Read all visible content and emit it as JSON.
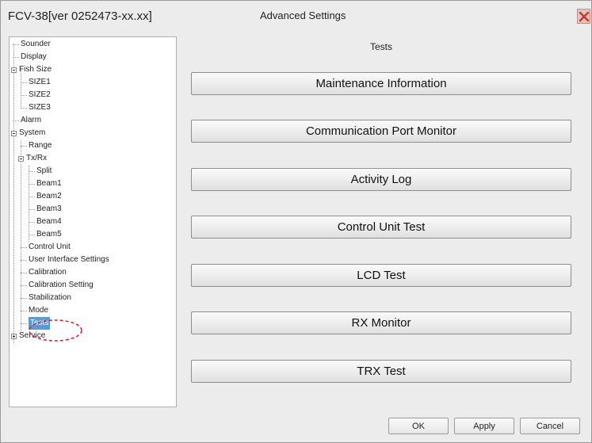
{
  "window": {
    "app_title": "FCV-38[ver 0252473-xx.xx]",
    "dialog_title": "Advanced Settings",
    "close_icon": "close-x-icon",
    "close_color": "#c0392b"
  },
  "tree": {
    "items": [
      {
        "label": "Sounder",
        "level": 0
      },
      {
        "label": "Display",
        "level": 0
      },
      {
        "label": "Fish Size",
        "level": 0,
        "expanded": true
      },
      {
        "label": "SIZE1",
        "level": 1
      },
      {
        "label": "SIZE2",
        "level": 1
      },
      {
        "label": "SIZE3",
        "level": 1
      },
      {
        "label": "Alarm",
        "level": 0
      },
      {
        "label": "System",
        "level": 0,
        "expanded": true
      },
      {
        "label": "Range",
        "level": 1
      },
      {
        "label": "Tx/Rx",
        "level": 1,
        "expanded": true
      },
      {
        "label": "Split",
        "level": 2
      },
      {
        "label": "Beam1",
        "level": 2
      },
      {
        "label": "Beam2",
        "level": 2
      },
      {
        "label": "Beam3",
        "level": 2
      },
      {
        "label": "Beam4",
        "level": 2
      },
      {
        "label": "Beam5",
        "level": 2
      },
      {
        "label": "Control Unit",
        "level": 1
      },
      {
        "label": "User Interface Settings",
        "level": 1
      },
      {
        "label": "Calibration",
        "level": 1
      },
      {
        "label": "Calibration Setting",
        "level": 1
      },
      {
        "label": "Stabilization",
        "level": 1
      },
      {
        "label": "Mode",
        "level": 1
      },
      {
        "label": "Tests",
        "level": 1,
        "selected": true
      },
      {
        "label": "Service",
        "level": 0,
        "expanded": false
      }
    ],
    "selection_color": "#5b9bd5",
    "annotation_color": "#d9262b"
  },
  "panel": {
    "title": "Tests",
    "buttons": [
      "Maintenance Information",
      "Communication Port Monitor",
      "Activity Log",
      "Control Unit Test",
      "LCD Test",
      "RX Monitor",
      "TRX Test"
    ]
  },
  "footer": {
    "ok": "OK",
    "apply": "Apply",
    "cancel": "Cancel"
  }
}
